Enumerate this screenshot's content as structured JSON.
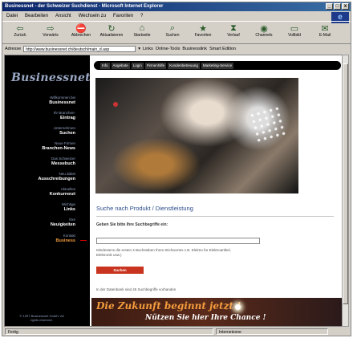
{
  "window": {
    "title": "Businessnet - der Schweizer Suchdienst - Microsoft Internet Explorer",
    "controls": [
      "_",
      "□",
      "x"
    ]
  },
  "menu": [
    "Datei",
    "Bearbeiten",
    "Ansicht",
    "Wechseln zu",
    "Favoriten",
    "?"
  ],
  "toolbar": [
    {
      "label": "Zurück",
      "icon": "back-arrow-icon",
      "glyph": "⇦"
    },
    {
      "label": "Vorwärts",
      "icon": "forward-arrow-icon",
      "glyph": "⇨"
    },
    {
      "label": "Abbrechen",
      "icon": "stop-icon",
      "glyph": "⛔"
    },
    {
      "label": "Aktualisieren",
      "icon": "refresh-icon",
      "glyph": "↻"
    },
    {
      "label": "Startseite",
      "icon": "home-icon",
      "glyph": "⌂"
    },
    {
      "label": "Suchen",
      "icon": "search-icon",
      "glyph": "⌕"
    },
    {
      "label": "Favoriten",
      "icon": "favorites-icon",
      "glyph": "★"
    },
    {
      "label": "Verlauf",
      "icon": "history-icon",
      "glyph": "⧗"
    },
    {
      "label": "Channels",
      "icon": "channels-icon",
      "glyph": "◉"
    },
    {
      "label": "Vollbild",
      "icon": "fullscreen-icon",
      "glyph": "▭"
    },
    {
      "label": "E-Mail",
      "icon": "mail-icon",
      "glyph": "✉"
    }
  ],
  "address": {
    "label": "Adresse",
    "url": "http://www.businessnet.ch/deutsch/main_d.asp",
    "links_label": "Links",
    "links": [
      "Online-Tools",
      "Businesslink",
      "Smart Edition"
    ]
  },
  "sidebar": {
    "logo": "Businessnet",
    "items": [
      {
        "sup": "Willkommen bei",
        "label": "Businessnet"
      },
      {
        "sup": "Ihr Branchen-",
        "label": "Eintrag"
      },
      {
        "sup": "Unternehmen",
        "label": "Suchen"
      },
      {
        "sup": "Neue Firmen",
        "label": "Branchen-News"
      },
      {
        "sup": "Das Schweizer",
        "label": "Messebuch"
      },
      {
        "sup": "Neu dabei",
        "label": "Ausschreibungen"
      },
      {
        "sup": "Aktuelles",
        "label": "Konkurrenzt"
      },
      {
        "sup": "Wichtige",
        "label": "Links"
      },
      {
        "sup": "Ihre",
        "label": "Neuigkeiten"
      },
      {
        "sup": "Kontakt",
        "label": "Business"
      }
    ],
    "copyright": "© 1997 Businessnet GmbH. All rights reserved."
  },
  "tabs": [
    "Info",
    "Angebote",
    "Login",
    "Firmenhilfe",
    "Kundenbetreuung",
    "Marketing-Service"
  ],
  "search": {
    "title": "Suche nach Produkt / Dienstleistung",
    "prompt": "Geben Sie bitte Ihre Suchbegriffe ein:",
    "input_value": "",
    "hint": "Mindestens die ersten 4 Buchstaben Ihres Stichwortes z.B. Elektro für Elektroartikel, Elektronik usw.)",
    "button_label": "Suchen",
    "status": "In der Datenbank sind 45 Suchbegriffe vorhanden"
  },
  "banner": {
    "line1": "Die Zukunft beginnt jetzt !",
    "line2": "Nützen Sie hier Ihre Chance !"
  },
  "statusbar": {
    "status": "Fertig",
    "zone": "Internetzone"
  }
}
